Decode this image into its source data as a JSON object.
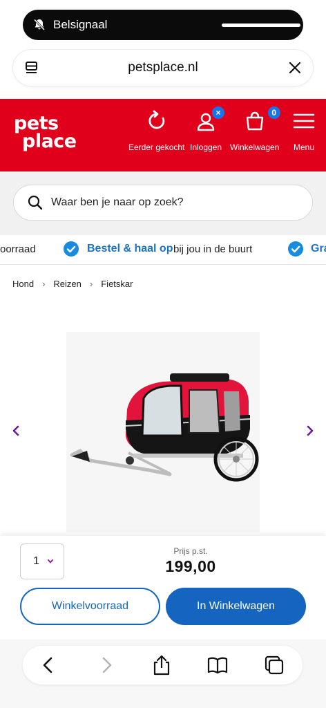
{
  "status": {
    "text": "Belsignaal",
    "icon": "bell-slash-icon"
  },
  "browser": {
    "url": "petsplace.nl"
  },
  "header": {
    "logo_line1": "pets",
    "logo_line2": "place",
    "nav": [
      {
        "label": "Eerder gekocht",
        "icon": "refresh-icon"
      },
      {
        "label": "Inloggen",
        "icon": "user-icon",
        "badge": "×"
      },
      {
        "label": "Winkelwagen",
        "icon": "basket-icon",
        "badge": "0"
      },
      {
        "label": "Menu",
        "icon": "hamburger-icon"
      }
    ]
  },
  "search": {
    "placeholder": "Waar ben je naar op zoek?"
  },
  "usp": {
    "prefix": "oorraad",
    "highlight": "Bestel & haal op",
    "rest": "bij jou in de buurt",
    "next": "Gra"
  },
  "breadcrumb": [
    "Hond",
    "Reizen",
    "Fietskar"
  ],
  "product": {
    "image": "bike-trailer-image"
  },
  "purchase": {
    "quantity": "1",
    "price_label": "Prijs p.st.",
    "price": "199,00",
    "stock_button": "Winkelvoorraad",
    "cart_button": "In Winkelwagen"
  },
  "colors": {
    "brand_red": "#e0001b",
    "primary_blue": "#1565c0",
    "check_blue": "#1a8ce0"
  }
}
